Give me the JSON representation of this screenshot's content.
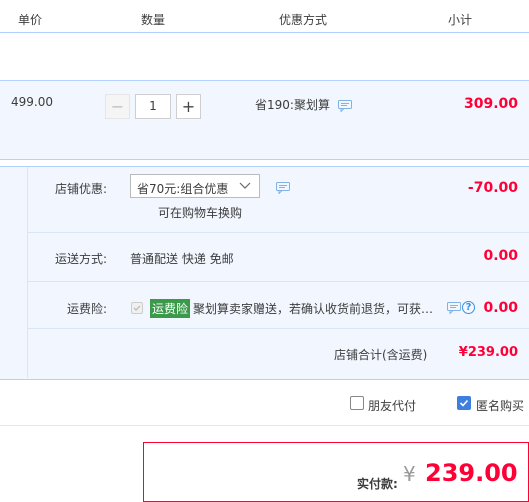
{
  "header": {
    "col_price": "单价",
    "col_qty": "数量",
    "col_discount": "优惠方式",
    "col_subtotal": "小计"
  },
  "item": {
    "price": "499.00",
    "quantity": "1",
    "minus": "−",
    "plus": "+",
    "discount": "省190:聚划算",
    "subtotal": "309.00"
  },
  "shop": {
    "coupon_label": "店铺优惠:",
    "coupon_selected": "省70元:组合优惠",
    "coupon_hint": "可在购物车换购",
    "coupon_amount": "-70.00",
    "shipping_label": "运送方式:",
    "shipping_value": "普通配送 快递 免邮",
    "shipping_amount": "0.00",
    "insurance_label": "运费险:",
    "insurance_tag": "运费险",
    "insurance_text": "聚划算卖家赠送，若确认收货前退货，可获…",
    "insurance_amount": "0.00",
    "total_label": "店铺合计(含运费)",
    "total_amount": "¥239.00"
  },
  "options": {
    "friend_pay": "朋友代付",
    "anonymous": "匿名购买"
  },
  "payment": {
    "label": "实付款:",
    "currency": "¥",
    "amount": "239.00"
  },
  "colors": {
    "accent_red": "#ff0036",
    "panel_bg": "#f2f7ff",
    "border_blue": "#b2d1ff",
    "checkbox_blue": "#3d7ee0",
    "tag_green": "#3a9a4a"
  }
}
